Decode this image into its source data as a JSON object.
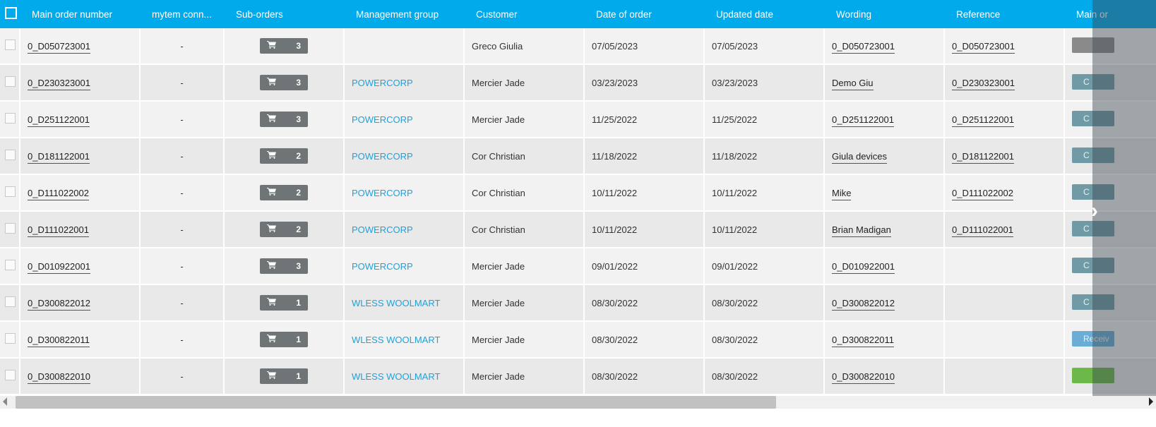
{
  "columns": [
    "Main order number",
    "mytem conn...",
    "Sub-orders",
    "Management group",
    "Customer",
    "Date of order",
    "Updated date",
    "Wording",
    "Reference",
    "Main or"
  ],
  "rows": [
    {
      "order": "0_D050723001",
      "conn": "-",
      "sub": "3",
      "group": "",
      "customer": "Greco Giulia",
      "date": "07/05/2023",
      "updated": "07/05/2023",
      "wording": "0_D050723001",
      "reference": "0_D050723001",
      "status": "",
      "status_color": "#8a8a8a"
    },
    {
      "order": "0_D230323001",
      "conn": "-",
      "sub": "3",
      "group": "POWERCORP",
      "customer": "Mercier Jade",
      "date": "03/23/2023",
      "updated": "03/23/2023",
      "wording": "Demo Giu",
      "reference": "0_D230323001",
      "status": "C",
      "status_color": "#6f9aa6"
    },
    {
      "order": "0_D251122001",
      "conn": "-",
      "sub": "3",
      "group": "POWERCORP",
      "customer": "Mercier Jade",
      "date": "11/25/2022",
      "updated": "11/25/2022",
      "wording": "0_D251122001",
      "reference": "0_D251122001",
      "status": "C",
      "status_color": "#6f9aa6"
    },
    {
      "order": "0_D181122001",
      "conn": "-",
      "sub": "2",
      "group": "POWERCORP",
      "customer": "Cor Christian",
      "date": "11/18/2022",
      "updated": "11/18/2022",
      "wording": "Giula devices",
      "reference": "0_D181122001",
      "status": "C",
      "status_color": "#6f9aa6"
    },
    {
      "order": "0_D111022002",
      "conn": "-",
      "sub": "2",
      "group": "POWERCORP",
      "customer": "Cor Christian",
      "date": "10/11/2022",
      "updated": "10/11/2022",
      "wording": "Mike",
      "reference": "0_D111022002",
      "status": "C",
      "status_color": "#6f9aa6"
    },
    {
      "order": "0_D111022001",
      "conn": "-",
      "sub": "2",
      "group": "POWERCORP",
      "customer": "Cor Christian",
      "date": "10/11/2022",
      "updated": "10/11/2022",
      "wording": "Brian Madigan",
      "reference": "0_D111022001",
      "status": "C",
      "status_color": "#6f9aa6"
    },
    {
      "order": "0_D010922001",
      "conn": "-",
      "sub": "3",
      "group": "POWERCORP",
      "customer": "Mercier Jade",
      "date": "09/01/2022",
      "updated": "09/01/2022",
      "wording": "0_D010922001",
      "reference": "",
      "status": "C",
      "status_color": "#6f9aa6"
    },
    {
      "order": "0_D300822012",
      "conn": "-",
      "sub": "1",
      "group": "WLESS WOOLMART",
      "customer": "Mercier Jade",
      "date": "08/30/2022",
      "updated": "08/30/2022",
      "wording": "0_D300822012",
      "reference": "",
      "status": "C",
      "status_color": "#6f9aa6"
    },
    {
      "order": "0_D300822011",
      "conn": "-",
      "sub": "1",
      "group": "WLESS WOOLMART",
      "customer": "Mercier Jade",
      "date": "08/30/2022",
      "updated": "08/30/2022",
      "wording": "0_D300822011",
      "reference": "",
      "status": "Receiv",
      "status_color": "#6aaed6"
    },
    {
      "order": "0_D300822010",
      "conn": "-",
      "sub": "1",
      "group": "WLESS WOOLMART",
      "customer": "Mercier Jade",
      "date": "08/30/2022",
      "updated": "08/30/2022",
      "wording": "0_D300822010",
      "reference": "",
      "status": "",
      "status_color": "#6cb94a"
    }
  ],
  "colors": {
    "header": "#00aaeb",
    "link": "#1aa3de"
  },
  "icons": {
    "cart": "cart-icon",
    "next": "chevron-right-icon"
  }
}
